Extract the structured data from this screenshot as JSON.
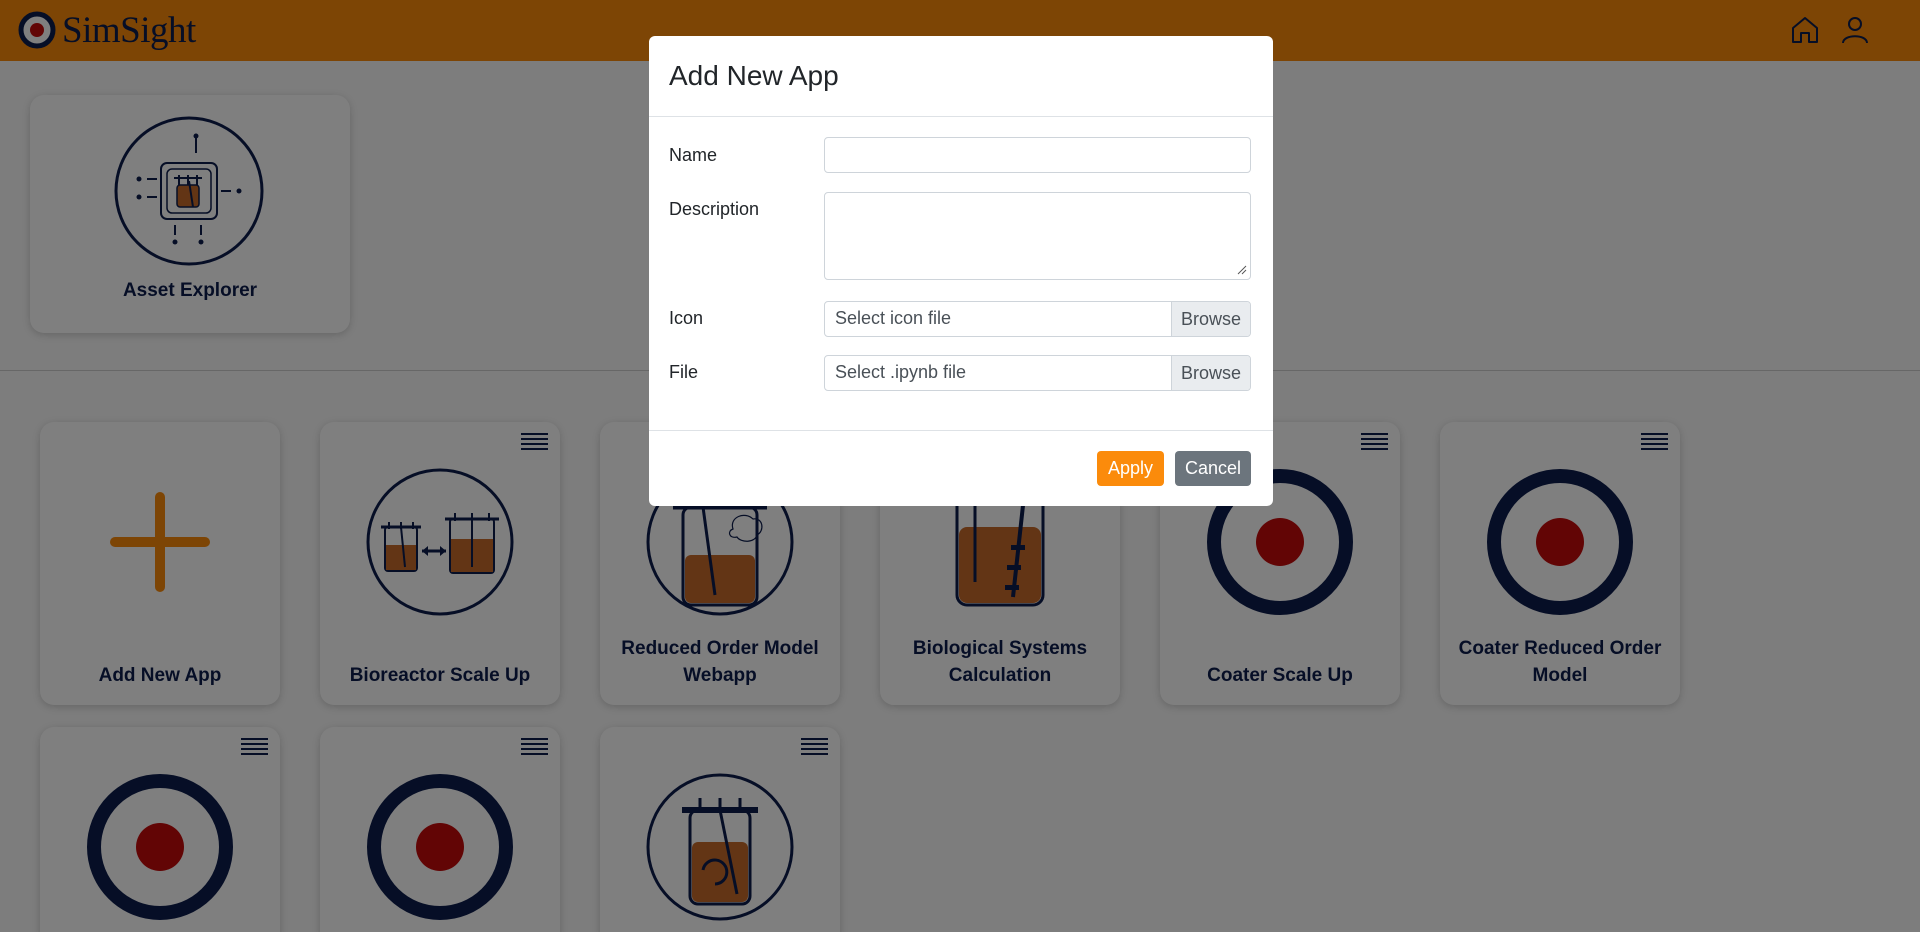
{
  "brand": {
    "name": "SimSight"
  },
  "colors": {
    "accent": "#fb8b0b",
    "navy": "#0c1c4c",
    "target_red": "#c40a0a",
    "brown": "#c66b2a"
  },
  "navbar": {
    "icons": [
      "home-icon",
      "user-icon"
    ]
  },
  "asset_explorer": {
    "label": "Asset Explorer"
  },
  "apps": [
    {
      "label": "Add New App",
      "icon": "plus-icon"
    },
    {
      "label": "Bioreactor Scale Up",
      "icon": "bioreactor-scale-up-icon"
    },
    {
      "label": "Reduced Order Model Webapp",
      "icon": "bioreactor-brain-icon"
    },
    {
      "label": "Biological Systems Calculation",
      "icon": "bioreactor-vessel-icon"
    },
    {
      "label": "Coater Scale Up",
      "icon": "target-icon"
    },
    {
      "label": "Coater Reduced Order Model",
      "icon": "target-icon"
    },
    {
      "label": "",
      "icon": "target-icon"
    },
    {
      "label": "",
      "icon": "target-icon"
    },
    {
      "label": "",
      "icon": "bioreactor-mix-icon"
    }
  ],
  "modal": {
    "title": "Add New App",
    "name_label": "Name",
    "name_value": "",
    "description_label": "Description",
    "description_value": "",
    "icon_label": "Icon",
    "icon_placeholder": "Select icon file",
    "file_label": "File",
    "file_placeholder": "Select .ipynb file",
    "browse_label": "Browse",
    "apply_label": "Apply",
    "cancel_label": "Cancel"
  }
}
